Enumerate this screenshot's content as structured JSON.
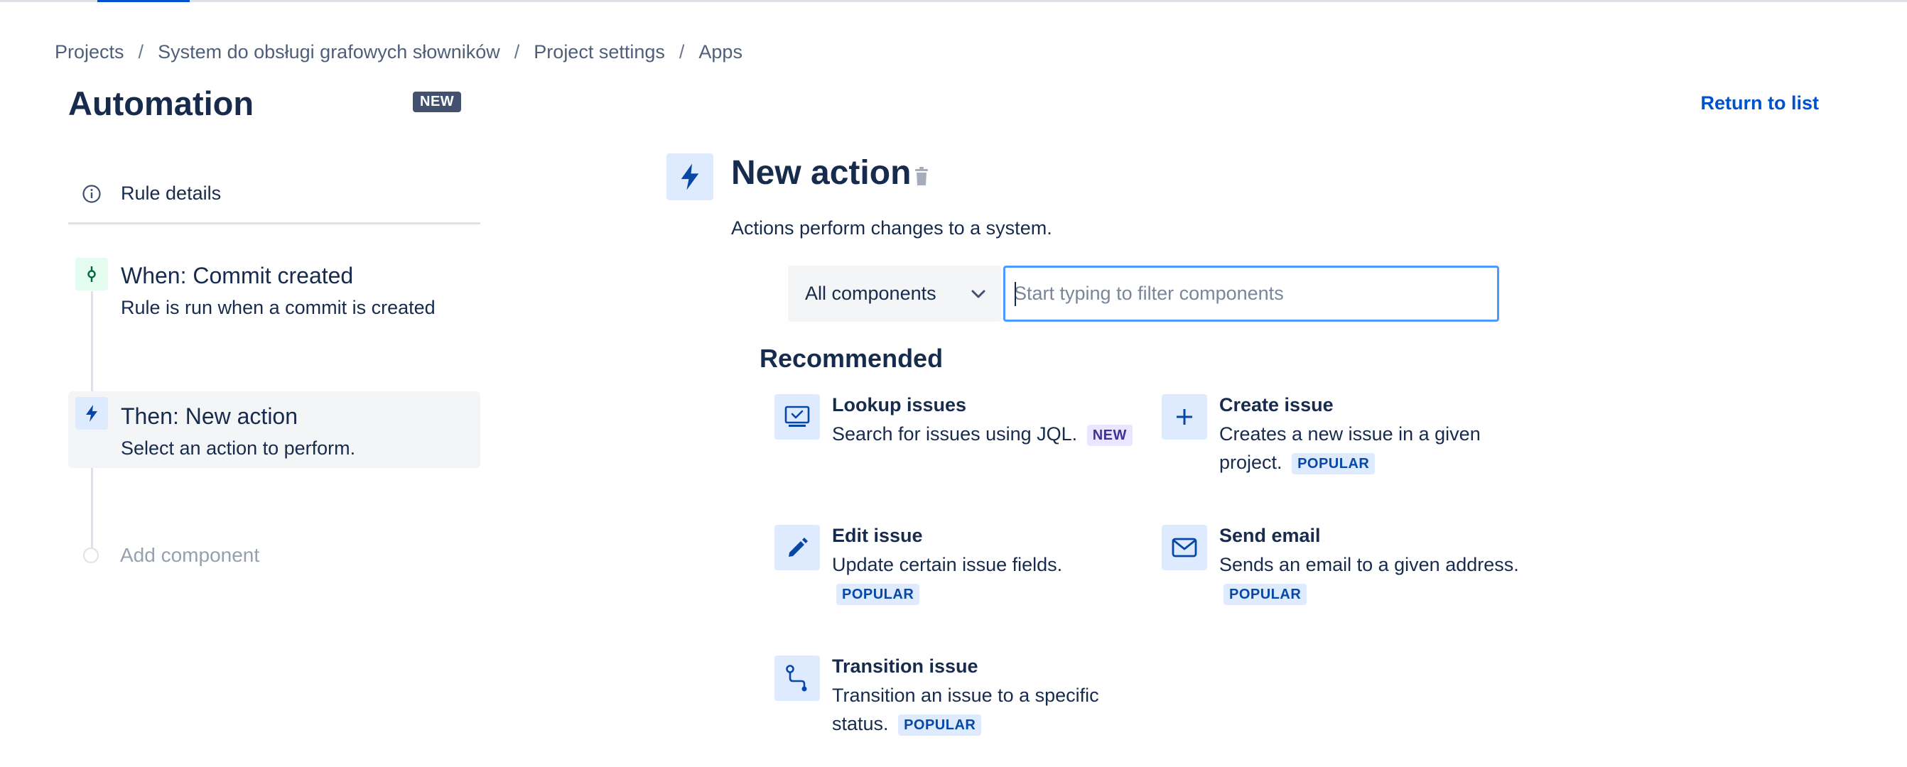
{
  "breadcrumb": {
    "items": [
      "Projects",
      "System do obsługi grafowych słowników",
      "Project settings",
      "Apps"
    ],
    "separator": "/"
  },
  "header": {
    "title": "Automation",
    "new_badge": "NEW",
    "return_link": "Return to list"
  },
  "sidebar": {
    "rule_details": "Rule details",
    "trigger": {
      "title": "When: Commit created",
      "desc": "Rule is run when a commit is created"
    },
    "action": {
      "title": "Then: New action",
      "desc": "Select an action to perform."
    },
    "add_component": "Add component"
  },
  "main": {
    "title": "New action",
    "desc": "Actions perform changes to a system.",
    "filter": {
      "select_value": "All components",
      "placeholder": "Start typing to filter components"
    },
    "recommended_heading": "Recommended",
    "cards": [
      {
        "name": "Lookup issues",
        "desc": "Search for issues using JQL.",
        "badge": "NEW",
        "icon": "lookup-icon"
      },
      {
        "name": "Create issue",
        "desc": "Creates a new issue in a given project.",
        "badge": "POPULAR",
        "icon": "plus-icon"
      },
      {
        "name": "Edit issue",
        "desc": "Update certain issue fields.",
        "badge": "POPULAR",
        "icon": "pencil-icon"
      },
      {
        "name": "Send email",
        "desc": "Sends an email to a given address.",
        "badge": "POPULAR",
        "icon": "envelope-icon"
      },
      {
        "name": "Transition issue",
        "desc": "Transition an issue to a specific status.",
        "badge": "POPULAR",
        "icon": "transition-icon"
      }
    ]
  },
  "colors": {
    "brand": "#0052cc",
    "text": "#172b4d",
    "focus": "#4c9aff",
    "icon_bg": "#deebff",
    "trigger_bg": "#e3fcef"
  }
}
